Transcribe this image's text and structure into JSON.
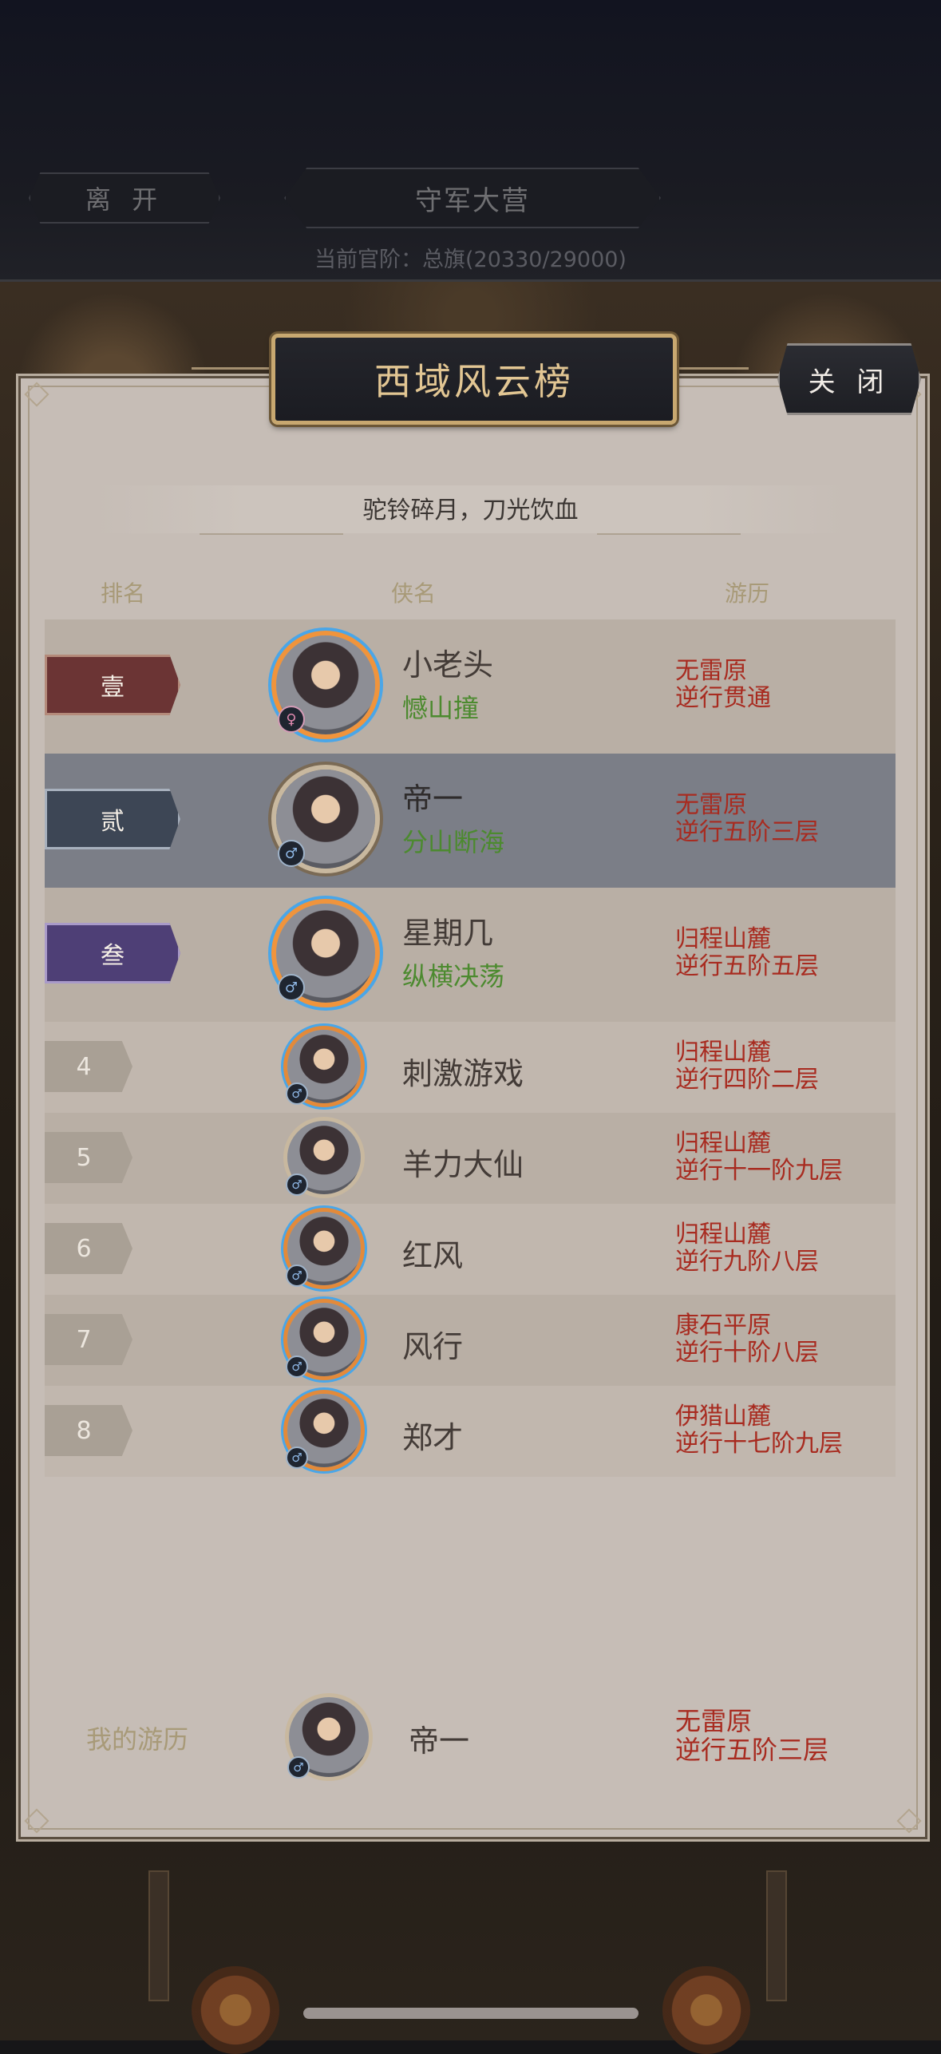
{
  "hud": {
    "leave_label": "离 开",
    "camp_label": "守军大营",
    "rank_line": "当前官阶：总旗(20330/29000)"
  },
  "panel": {
    "title": "西域风云榜",
    "close_label": "关 闭",
    "subtitle": "驼铃碎月，刀光饮血",
    "columns": {
      "rank": "排名",
      "name": "侠名",
      "travel": "游历"
    }
  },
  "rows": [
    {
      "rank": "壹",
      "name": "小老头",
      "skill": "憾山撞",
      "zone": "无雷原",
      "stage": "逆行贯通",
      "gender": "♀"
    },
    {
      "rank": "贰",
      "name": "帝一",
      "skill": "分山断海",
      "zone": "无雷原",
      "stage": "逆行五阶三层",
      "gender": "♂"
    },
    {
      "rank": "叁",
      "name": "星期几",
      "skill": "纵横决荡",
      "zone": "归程山麓",
      "stage": "逆行五阶五层",
      "gender": "♂"
    },
    {
      "rank": "4",
      "name": "刺激游戏",
      "zone": "归程山麓",
      "stage": "逆行四阶二层",
      "gender": "♂"
    },
    {
      "rank": "5",
      "name": "羊力大仙",
      "zone": "归程山麓",
      "stage": "逆行十一阶九层",
      "gender": "♂"
    },
    {
      "rank": "6",
      "name": "红风",
      "zone": "归程山麓",
      "stage": "逆行九阶八层",
      "gender": "♂"
    },
    {
      "rank": "7",
      "name": "风行",
      "zone": "康石平原",
      "stage": "逆行十阶八层",
      "gender": "♂"
    },
    {
      "rank": "8",
      "name": "郑才",
      "zone": "伊猎山麓",
      "stage": "逆行十七阶九层",
      "gender": "♂"
    }
  ],
  "my_record": {
    "label": "我的游历",
    "name": "帝一",
    "zone": "无雷原",
    "stage": "逆行五阶三层",
    "gender": "♂"
  },
  "colors": {
    "zone_text": "#a82b20",
    "skill_text": "#4c8a2f",
    "highlight_row": "#7b7e87",
    "title_text": "#e2c693"
  }
}
